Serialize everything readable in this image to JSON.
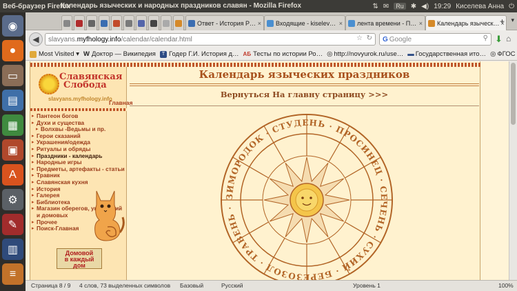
{
  "top_panel": {
    "app_name": "Веб-браузер Firefox",
    "window_title": "Календарь языческих и народных праздников славян - Mozilla Firefox",
    "keyboard_layout": "Ru",
    "time": "19:29",
    "user": "Киселева Анна"
  },
  "tabs": [
    {
      "label": "Ответ - История Р…",
      "color": "#3b6db1"
    },
    {
      "label": "Входящие - kiselev…",
      "color": "#4a8fd0"
    },
    {
      "label": "лента времени - П…",
      "color": "#4a8fd0"
    },
    {
      "label": "Календарь языческ…",
      "color": "#d58a2a",
      "active": true
    }
  ],
  "navbar": {
    "url_prefix": "slavyans.",
    "url_host": "myfhology.info",
    "url_path": "/calendar/calendar.html",
    "search_placeholder": "Google",
    "search_engine": "G"
  },
  "bookmarks": [
    {
      "label": "Most Visited ▾",
      "icon": "bookmark-folder-icon"
    },
    {
      "label": "Доктор — Википедия",
      "icon": "wikipedia-icon",
      "glyph": "W"
    },
    {
      "label": "Годер Г.И. История д…",
      "icon": "site-icon",
      "glyph": "T"
    },
    {
      "label": "Тесты по истории Ро…",
      "icon": "site-icon",
      "glyph": "АБ"
    },
    {
      "label": "http://novyurok.ru/use…",
      "icon": "globe-icon",
      "glyph": "◎"
    },
    {
      "label": "Государственная ито…",
      "icon": "site-icon",
      "glyph": "▬"
    },
    {
      "label": "ФГОС »",
      "icon": "globe-icon",
      "glyph": "◎"
    }
  ],
  "sidebar": {
    "logo_line1": "Славянская",
    "logo_line2": "Слобода",
    "logo_url": "slavyans.myfhology.info",
    "home_link": "Главная",
    "menu": [
      {
        "label": "Пантеон богов"
      },
      {
        "label": "Духи и существа"
      },
      {
        "label": "Волхвы -Ведьмы и пр.",
        "sub": true
      },
      {
        "label": "Герои сказаний"
      },
      {
        "label": "Украшения/одежда"
      },
      {
        "label": "Ритуалы и обряды"
      },
      {
        "label": "Праздники - календарь",
        "active": true
      },
      {
        "label": "Народные игры"
      },
      {
        "label": "Предметы, артефакты - статьи"
      },
      {
        "label": "Травник"
      },
      {
        "label": "Славянская кухня"
      },
      {
        "label": "История"
      },
      {
        "label": "Галерея"
      },
      {
        "label": "Библиотека"
      },
      {
        "label": "Магазин оберегов, украшений и домовых"
      },
      {
        "label": "Прочее"
      },
      {
        "label": "Поиск-Главная"
      }
    ],
    "ad_line1": "Домовой",
    "ad_line2": "в каждый",
    "ad_line3": "дом"
  },
  "main": {
    "title": "Календарь языческих праздников",
    "back_link": "Вернуться На главну страницу >>>",
    "calendar_ring_text": "ЗИМОРОДОК · СТУДЕНЬ · ПРОСИНЕЦ · СЕЧЕНЬ · СУХИЙ · БЕРЕЗОЗОЛ · ТРАВЕНЬ · ЛИСТОПАД · ГРУДЕНЬ · ЗАРЕВ"
  },
  "statusbar": {
    "page": "Страница 8 / 9",
    "words": "4 слов, 73 выделенных символов",
    "style": "Базовый",
    "language": "Русский",
    "level": "Уровень 1",
    "zoom": "100%"
  },
  "colors": {
    "accent": "#a8511d",
    "page_bg": "#fff2cf",
    "sidebar_bg": "#fde5b3"
  }
}
